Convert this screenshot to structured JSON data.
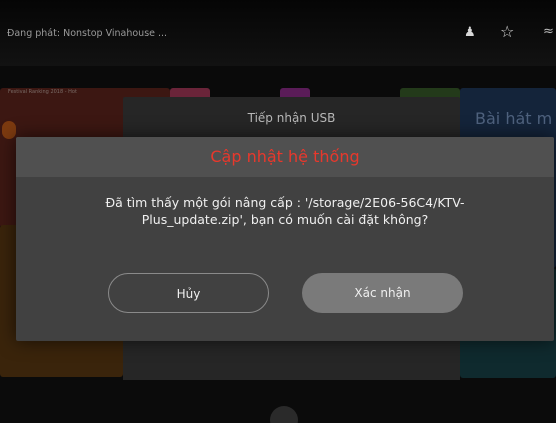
{
  "status_bar": {
    "now_playing_label": "Đang phát:",
    "now_playing_title": "Nonstop Vinahouse ...",
    "icons": [
      "user-icon",
      "star-icon",
      "wifi-icon"
    ]
  },
  "background": {
    "tile_caption": "Festival Ranking 2018 - Hot",
    "heading": "Bài hát m"
  },
  "usb_panel": {
    "title": "Tiếp nhận USB"
  },
  "dialog": {
    "title": "Cập nhật hệ thống",
    "message": "Đã tìm thấy một gói nâng cấp : '/storage/2E06-56C4/KTV-Plus_update.zip', bạn có muốn cài đặt không?",
    "cancel_label": "Hủy",
    "confirm_label": "Xác nhận",
    "title_color": "#e8382c"
  }
}
